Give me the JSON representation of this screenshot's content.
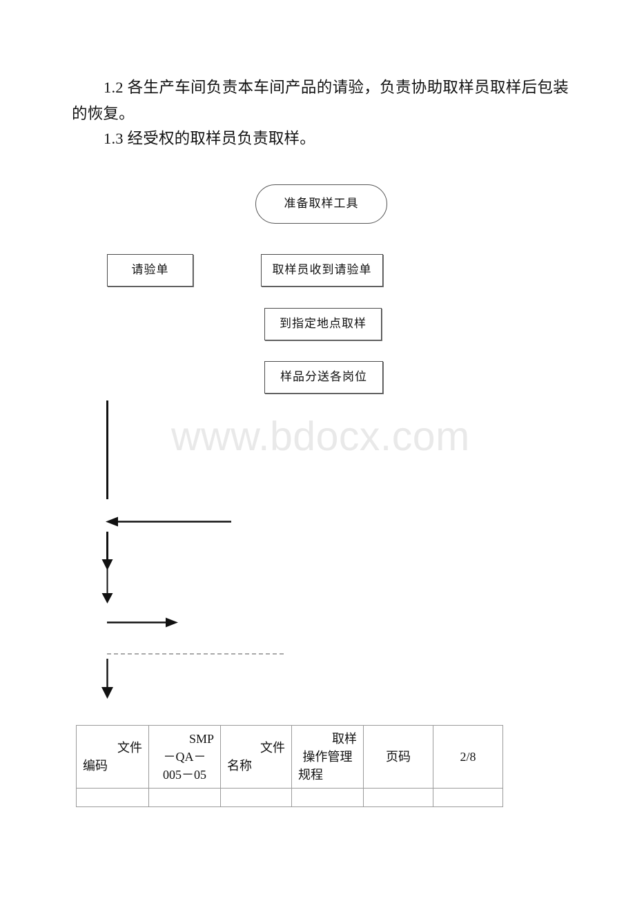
{
  "document": {
    "paragraphs": [
      {
        "id": "clause-1-2",
        "text": "1.2 各生产车间负责本车间产品的请验，负责协助取样员取样后包装的恢复。"
      },
      {
        "id": "clause-1-3",
        "text": "1.3 经受权的取样员负责取样。"
      }
    ],
    "watermark": "www.bdocx.com"
  },
  "flowchart": {
    "nodes": [
      {
        "id": "prepare-tools",
        "shape": "pill",
        "label": "准备取样工具"
      },
      {
        "id": "request-form",
        "shape": "rect",
        "label": "请验单"
      },
      {
        "id": "receive-form",
        "shape": "rect",
        "label": "取样员收到请验单"
      },
      {
        "id": "go-sample",
        "shape": "rect",
        "label": "到指定地点取样"
      },
      {
        "id": "distribute",
        "shape": "rect",
        "label": "样品分送各岗位"
      }
    ],
    "connectors": [
      {
        "id": "trunk-line",
        "type": "vertical-line"
      },
      {
        "id": "arrow-left-return",
        "type": "arrow-left"
      },
      {
        "id": "arrow-down-1",
        "type": "arrow-down"
      },
      {
        "id": "arrow-down-2",
        "type": "arrow-down"
      },
      {
        "id": "arrow-right-branch",
        "type": "arrow-right"
      },
      {
        "id": "dashed-divider",
        "type": "dashed-line"
      },
      {
        "id": "arrow-down-3",
        "type": "arrow-down"
      }
    ]
  },
  "footer_table": {
    "row_main": [
      {
        "id": "doc-code-label",
        "lines": [
          "文件",
          "编码"
        ],
        "align": [
          "r",
          "l"
        ]
      },
      {
        "id": "doc-code-value",
        "lines": [
          "SMP",
          "－QA－",
          "005－05"
        ],
        "align": [
          "r",
          "c",
          "c"
        ]
      },
      {
        "id": "doc-name-label",
        "lines": [
          "文件",
          "名称"
        ],
        "align": [
          "r",
          "l"
        ]
      },
      {
        "id": "doc-name-value",
        "lines": [
          "取样",
          "操作管理",
          "规程"
        ],
        "align": [
          "r",
          "c",
          "l"
        ]
      },
      {
        "id": "page-label",
        "lines": [
          "页码"
        ],
        "align": [
          "c"
        ]
      },
      {
        "id": "page-value",
        "lines": [
          "2/8"
        ],
        "align": [
          "c"
        ]
      }
    ],
    "row_blank": [
      {
        "id": "blank-1",
        "lines": [
          ""
        ]
      },
      {
        "id": "blank-2",
        "lines": [
          ""
        ]
      },
      {
        "id": "blank-3",
        "lines": [
          ""
        ]
      },
      {
        "id": "blank-4",
        "lines": [
          ""
        ]
      },
      {
        "id": "blank-5",
        "lines": [
          ""
        ]
      },
      {
        "id": "blank-6",
        "lines": [
          ""
        ]
      }
    ]
  }
}
